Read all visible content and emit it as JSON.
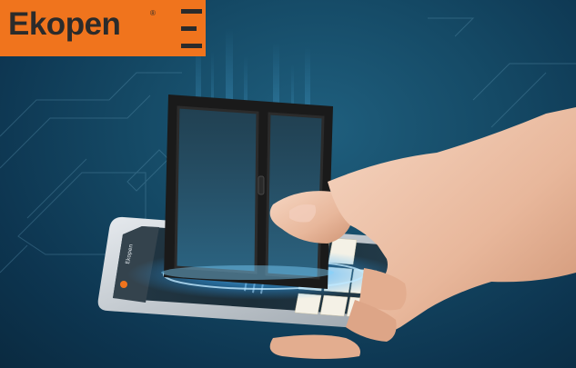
{
  "brand": {
    "name": "Ekopen",
    "registered_mark": "®",
    "accent_color": "#f0741d",
    "text_color": "#2b2b2b"
  },
  "scene": {
    "background_color": "#154a66",
    "glow_color": "#2fa8ff",
    "window_frame_color": "#1a1a1a"
  },
  "app_screen": {
    "header_title": "Ekopen"
  }
}
